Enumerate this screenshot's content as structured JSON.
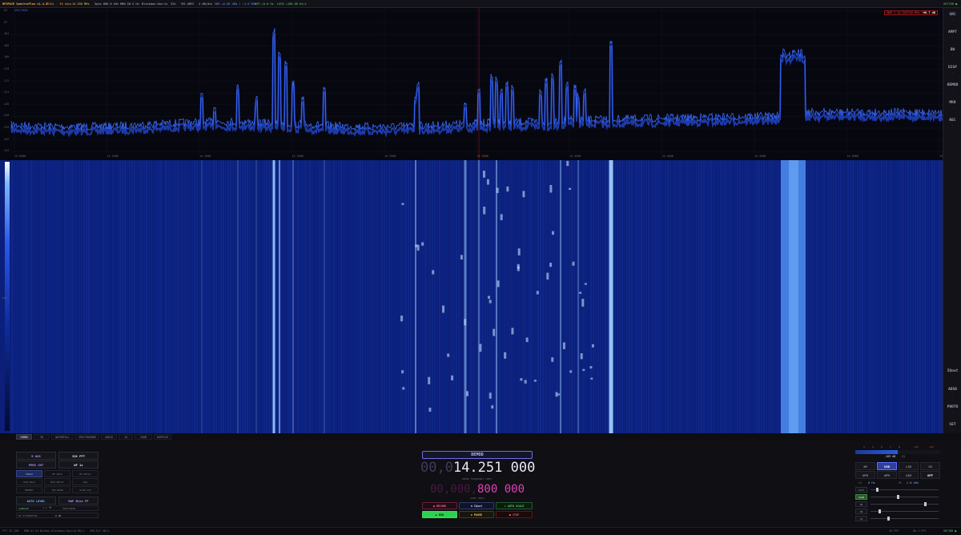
{
  "topbar": {
    "app_title": "HFSPACE SpectraFlux v1.4.2",
    "trial": "TRIAL · 30 days",
    "center_freq": "14.250 MHz",
    "span": "Span 800.0 kHz",
    "rbw": "RBW 58.5 Hz",
    "window": "Blackman-Harris",
    "fft": "32k",
    "ref": "−85 dBFS",
    "scale": "4 dB/div",
    "snr": "SNR +6.08 dBm / −4.0 MHz",
    "osp": "OSP +0.0 Hz",
    "lock": "LOCK +100.00 Hz/s",
    "right_tag": "VECTOR ●"
  },
  "spectrum": {
    "trace_label": "SPECTRUM",
    "marker_readout": "MKR 1 14.343750 MHz",
    "marker_value": "-96.7 dB",
    "y_labels": [
      "-93",
      "-97",
      "-101",
      "-105",
      "-109",
      "-113",
      "-117",
      "-121",
      "-125",
      "-129",
      "-133",
      "-137",
      "-141"
    ],
    "x_labels": [
      "14.0500",
      "14.1000",
      "14.1500",
      "14.2000",
      "14.2500",
      "14.3000",
      "14.3500",
      "14.4000",
      "14.4500",
      "14.5000",
      "14.5500"
    ],
    "trace_color": "#3a6cff",
    "marker_color": "#c03030"
  },
  "waterfall": {
    "base_color": "#0b1f7a",
    "hot_color": "#7cb7ff",
    "scale_labels": [
      "-85",
      "-117"
    ]
  },
  "right_panel": {
    "buttons": [
      {
        "label": "SRC",
        "sub": "⌄"
      },
      {
        "label": "AMPT",
        "sub": "⌄"
      },
      {
        "label": "BW",
        "sub": "⌄"
      },
      {
        "label": "DISP",
        "sub": "⌄"
      },
      {
        "label": "DEMOD",
        "sub": "⌄"
      },
      {
        "label": "MKR",
        "sub": "⌄"
      },
      {
        "label": "REC",
        "sub": "⌄"
      },
      {
        "label": "IQout",
        "sub": "⌄"
      },
      {
        "label": "ADSB",
        "sub": "⌄"
      },
      {
        "label": "PHOTO",
        "sub": "⌄"
      },
      {
        "label": "SET",
        "sub": "⌄"
      }
    ]
  },
  "tabs": [
    "COMBO",
    "3D",
    "WATERFALL",
    "SPECTROGRAM",
    "AUDIO",
    "IQ",
    "ZOOM",
    "DOPPLER"
  ],
  "left_panel": {
    "top_a": "≡ AVG",
    "top_b": "32K FFT",
    "mid_a": "PERS CNT",
    "mid_b": "WF 1x",
    "grid": [
      "TRACE",
      "PK HOLD",
      "PK DECAY",
      "MIN HOLD",
      "MIN DECAY",
      "AVG",
      "MEMORY",
      "THS NEON",
      "SLOW AVG"
    ],
    "auto_level": "AUTO LEVEL",
    "palette": "MAP Blue FF",
    "avg_label": "AVERAGE",
    "avg_ctrl": "◂ ▸ ⟲",
    "smoothing": "SMOOTHING",
    "attenuator": "RF ATTENUATOR",
    "att_value": "0 dB"
  },
  "center": {
    "demod": "DEMOD",
    "freq_dim": "00,0",
    "freq_main": "14.251 000",
    "freq_label": "DEMOD FREQUENCY (MHZ)",
    "span_dim": "00,000,",
    "span_main": "800 000",
    "span_label": "SPAN (MHZ)",
    "record": "● RECORD",
    "iqout": "⊕ IQout",
    "autoscale": "⇕ AUTO SCALE",
    "run": "▶ RUN",
    "pause": "⏸ PAUSE",
    "stop": "■ STOP"
  },
  "right_bottom": {
    "meter_ticks": [
      "1",
      "3",
      "5",
      "7",
      "9",
      "+20",
      "+40"
    ],
    "meter_value": "-103 dB",
    "meter_unit": "S1",
    "modes": [
      "AM",
      "USB",
      "LSB",
      "CW",
      "NFM",
      "WFM",
      "SAM",
      "OFF"
    ],
    "selected_mode": "USB",
    "bw_lo_label": "LO",
    "bw_lo": "0 Hz",
    "bw_hi_label": "HI",
    "bw_hi": "2.8 kHz",
    "sliders": [
      {
        "tag": "AUTO",
        "on": false,
        "level": 0.08
      },
      {
        "tag": "SLOW",
        "on": true,
        "level": 0.4
      },
      {
        "tag": "NR",
        "on": false,
        "level": 0.82
      },
      {
        "tag": "NB",
        "on": false,
        "level": 0.12
      },
      {
        "tag": "SQ",
        "on": false,
        "level": 0.25
      }
    ]
  },
  "statusbar": {
    "fft": "FFT 32,768",
    "rbw": "RBW 61 Hz",
    "window": "Window Blackman-Harris",
    "rate": "1 MS/s",
    "bytes": "256,817 dB/s",
    "fps": "30 FPS",
    "cpu": "60.1 FPS",
    "right": "VECTOR ●"
  }
}
